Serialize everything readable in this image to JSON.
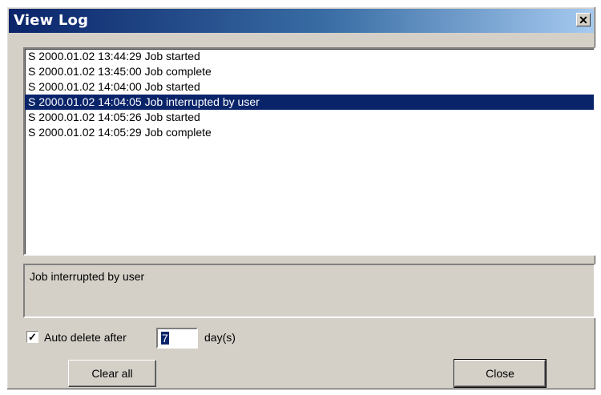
{
  "window": {
    "title": "View Log",
    "close_glyph": "✕"
  },
  "log": {
    "entries": [
      "S 2000.01.02 13:44:29  Job started",
      "S 2000.01.02 13:45:00  Job complete",
      "S 2000.01.02 14:04:00  Job started",
      "S 2000.01.02 14:04:05  Job interrupted by user",
      "S 2000.01.02 14:05:26  Job started",
      "S 2000.01.02 14:05:29  Job complete"
    ],
    "selected_index": 3
  },
  "detail": {
    "text": "Job interrupted by user"
  },
  "auto_delete": {
    "checked": true,
    "label": "Auto delete after",
    "days_value": "7",
    "days_label": "day(s)"
  },
  "buttons": {
    "clear_all": "Clear all",
    "close": "Close"
  }
}
